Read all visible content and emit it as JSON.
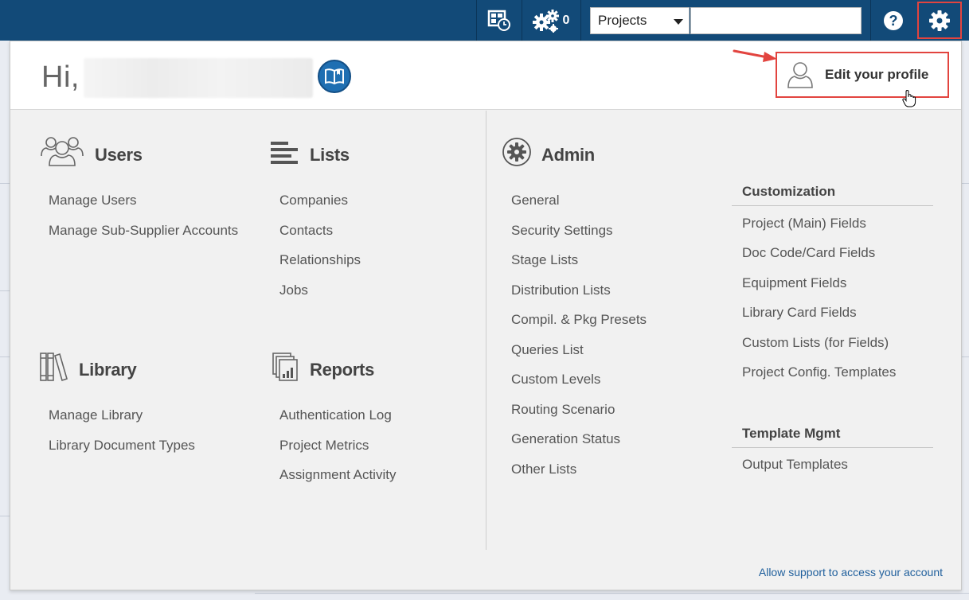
{
  "topbar": {
    "counter_value": "0",
    "project_select": {
      "value": "Projects"
    },
    "search": {
      "placeholder": ""
    },
    "colors": {
      "bar": "#124a78",
      "highlight": "#e2443f"
    }
  },
  "header": {
    "greeting": "Hi,",
    "edit_profile_label": "Edit your profile"
  },
  "users": {
    "title": "Users",
    "items": [
      "Manage Users",
      "Manage Sub-Supplier Accounts"
    ]
  },
  "lists": {
    "title": "Lists",
    "items": [
      "Companies",
      "Contacts",
      "Relationships",
      "Jobs"
    ]
  },
  "library": {
    "title": "Library",
    "items": [
      "Manage Library",
      "Library Document Types"
    ]
  },
  "reports": {
    "title": "Reports",
    "items": [
      "Authentication Log",
      "Project Metrics",
      "Assignment Activity"
    ]
  },
  "admin": {
    "title": "Admin",
    "items": [
      "General",
      "Security Settings",
      "Stage Lists",
      "Distribution Lists",
      "Compil. & Pkg Presets",
      "Queries List",
      "Custom Levels",
      "Routing Scenario",
      "Generation Status",
      "Other Lists"
    ],
    "customization": {
      "title": "Customization",
      "items": [
        "Project (Main) Fields",
        "Doc Code/Card Fields",
        "Equipment Fields",
        "Library Card Fields",
        "Custom Lists (for Fields)",
        "Project Config. Templates"
      ]
    },
    "template_mgmt": {
      "title": "Template Mgmt",
      "items": [
        "Output Templates"
      ]
    }
  },
  "footer": {
    "support_link": "Allow support to access your account"
  }
}
